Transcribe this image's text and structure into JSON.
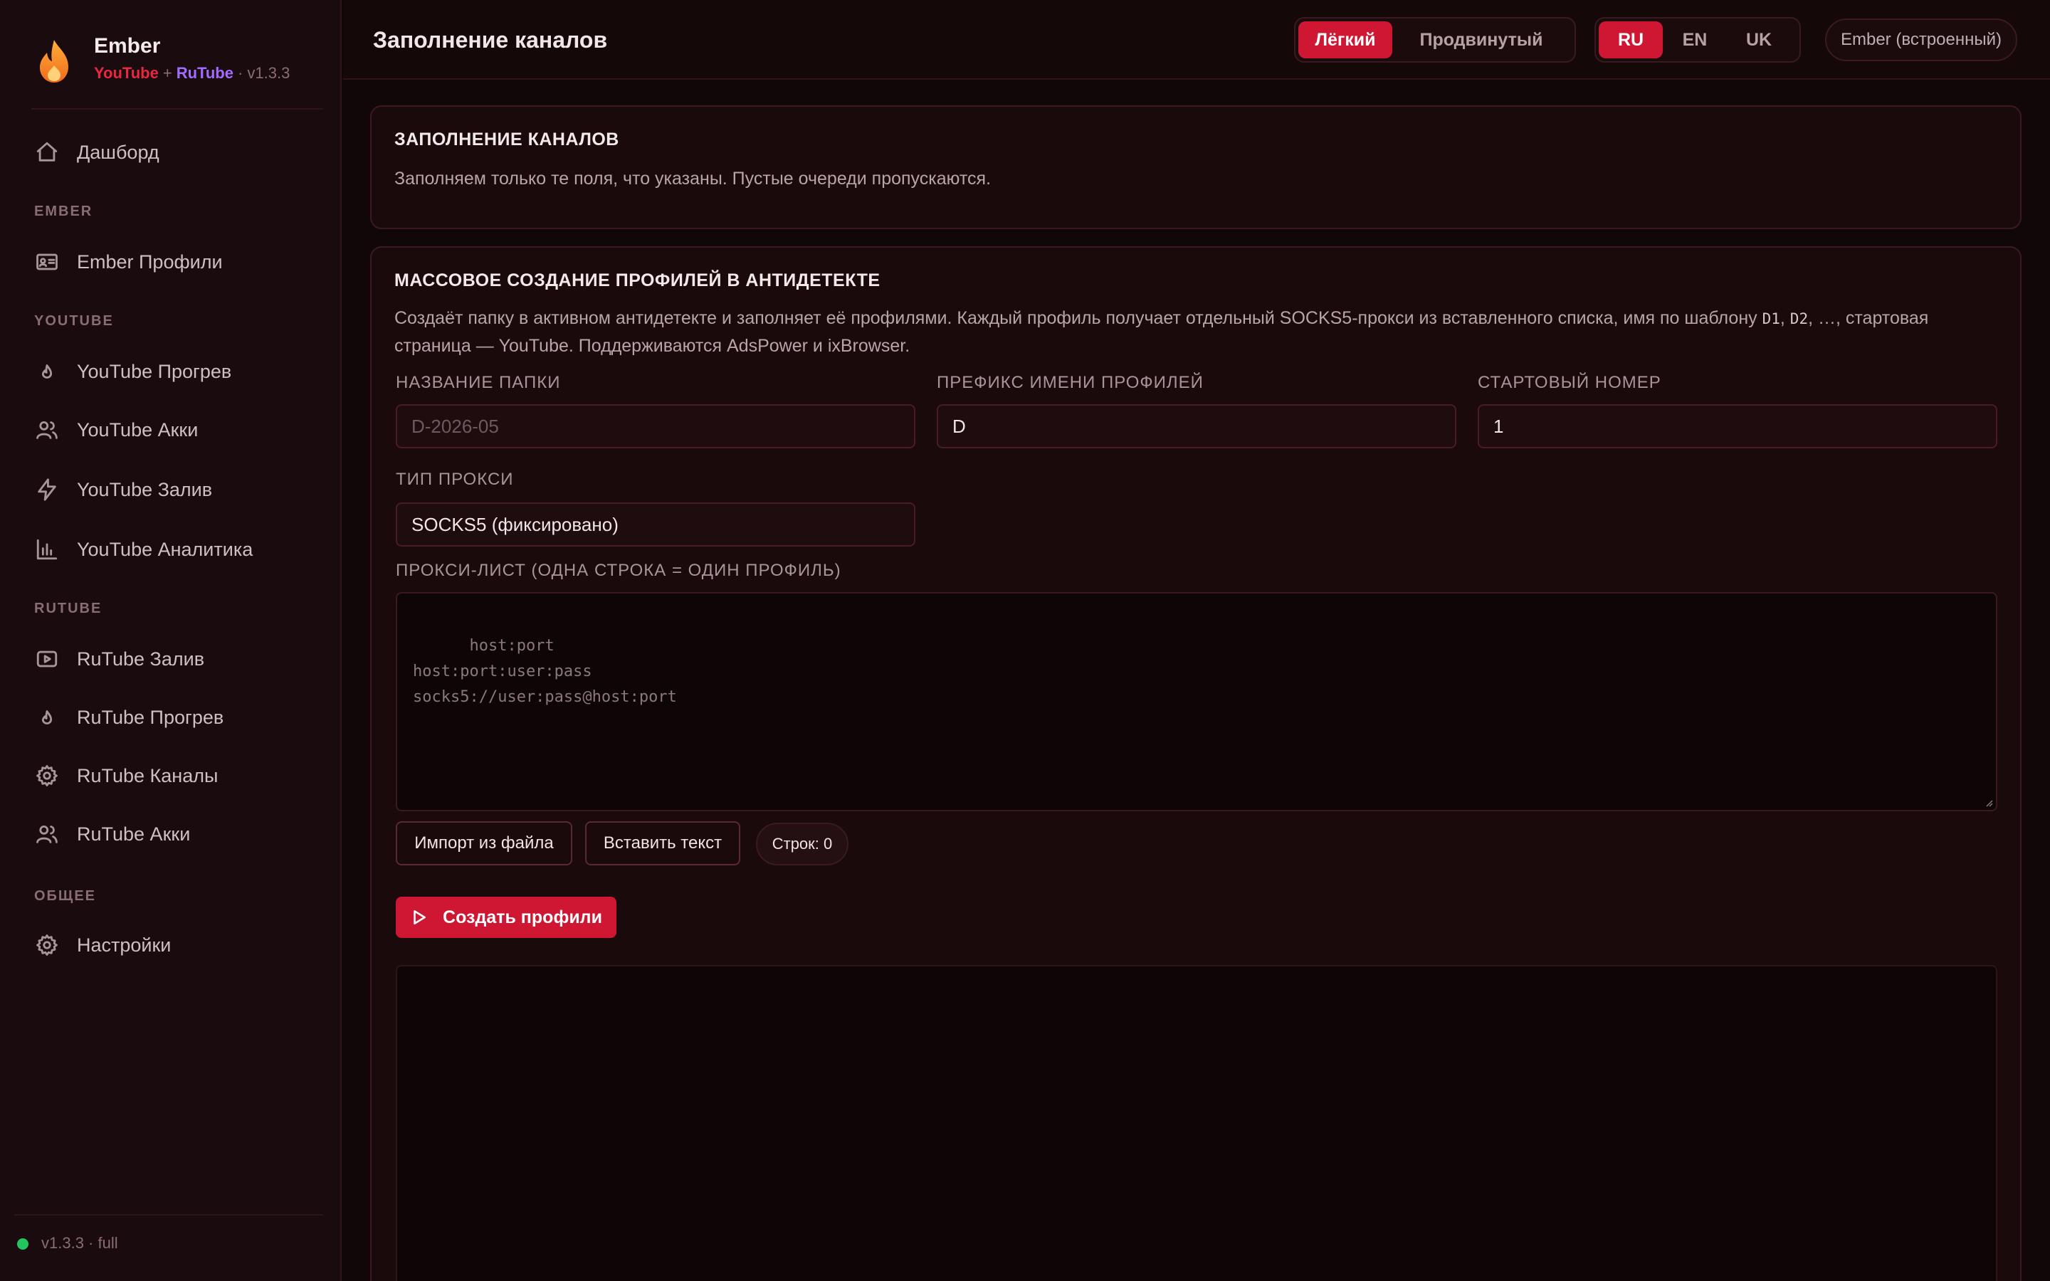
{
  "brand": {
    "name": "Ember",
    "sub_youtube": "YouTube",
    "sub_plus": "+",
    "sub_rutube": "RuTube",
    "sub_version": "· v1.3.3"
  },
  "sidebar": {
    "dashboard": "Дашборд",
    "sections": {
      "ember": "EMBER",
      "youtube": "YOUTUBE",
      "rutube": "RUTUBE",
      "general": "ОБЩЕЕ"
    },
    "items": {
      "ember_profiles": "Ember Профили",
      "yt_warmup": "YouTube Прогрев",
      "yt_accounts": "YouTube Акки",
      "yt_upload": "YouTube Залив",
      "yt_analytics": "YouTube Аналитика",
      "rt_upload": "RuTube Залив",
      "rt_warmup": "RuTube Прогрев",
      "rt_channels": "RuTube Каналы",
      "rt_accounts": "RuTube Акки",
      "settings": "Настройки"
    },
    "status": "v1.3.3 · full",
    "status_color": "#22c55e"
  },
  "header": {
    "title": "Заполнение каналов",
    "mode_options": [
      "Лёгкий",
      "Продвинутый"
    ],
    "mode_selected": "Лёгкий",
    "lang_options": [
      "RU",
      "EN",
      "UK"
    ],
    "lang_selected": "RU",
    "engine": "Ember (встроенный)"
  },
  "info_card": {
    "title": "ЗАПОЛНЕНИЕ КАНАЛОВ",
    "description": "Заполняем только те поля, что указаны. Пустые очереди пропускаются."
  },
  "bulk_card": {
    "title": "МАССОВОЕ СОЗДАНИЕ ПРОФИЛЕЙ В АНТИДЕТЕКТЕ",
    "desc_part1": "Создаёт папку в активном антидетекте и заполняет её профилями. Каждый профиль получает отдельный SOCKS5-прокси из вставленного списка, имя по шаблону ",
    "desc_code1": "D1",
    "desc_sep": ", ",
    "desc_code2": "D2",
    "desc_part2": ", …, стартовая страница — YouTube. Поддерживаются AdsPower и ixBrowser.",
    "folder_label": "НАЗВАНИЕ ПАПКИ",
    "folder_placeholder": "D-2026-05",
    "prefix_label": "ПРЕФИКС ИМЕНИ ПРОФИЛЕЙ",
    "prefix_value": "D",
    "start_label": "СТАРТОВЫЙ НОМЕР",
    "start_value": "1",
    "proxy_type_label": "ТИП ПРОКСИ",
    "proxy_type_value": "SOCKS5 (фиксировано)",
    "proxy_list_label": "ПРОКСИ-ЛИСТ (ОДНА СТРОКА = ОДИН ПРОФИЛЬ)",
    "proxy_list_placeholder": "host:port\nhost:port:user:pass\nsocks5://user:pass@host:port",
    "import_button": "Импорт из файла",
    "paste_button": "Вставить текст",
    "rows_counter": "Строк: 0",
    "create_button": "Создать профили"
  },
  "colors": {
    "accent": "#cf1733",
    "youtube": "#e8283f",
    "rutube": "#a46bff",
    "background": "#120708"
  }
}
